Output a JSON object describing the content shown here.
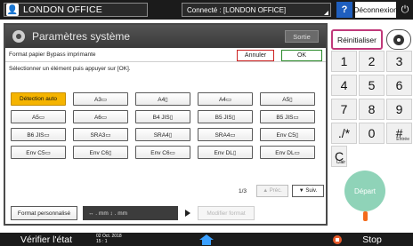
{
  "topbar": {
    "user": "LONDON OFFICE",
    "connection": "Connecté : [LONDON OFFICE]",
    "help": "?",
    "logout": "Déconnexion",
    "power_icon": "power-icon"
  },
  "window": {
    "title": "Paramètres système",
    "exit": "Sortie",
    "heading": "Format papier Bypass imprimante",
    "cancel": "Annuler",
    "ok": "OK",
    "instruction": "Sélectionner un élément puis appuyer sur [OK]."
  },
  "sizes": [
    {
      "label": "Détection auto",
      "selected": true
    },
    {
      "label": "A3▭",
      "selected": false
    },
    {
      "label": "A4▯",
      "selected": false
    },
    {
      "label": "A4▭",
      "selected": false
    },
    {
      "label": "A5▯",
      "selected": false
    },
    {
      "label": "A5▭",
      "selected": false
    },
    {
      "label": "A6▭",
      "selected": false
    },
    {
      "label": "B4 JIS▯",
      "selected": false
    },
    {
      "label": "B5 JIS▯",
      "selected": false
    },
    {
      "label": "B5 JIS▭",
      "selected": false
    },
    {
      "label": "B6 JIS▭",
      "selected": false
    },
    {
      "label": "SRA3▭",
      "selected": false
    },
    {
      "label": "SRA4▯",
      "selected": false
    },
    {
      "label": "SRA4▭",
      "selected": false
    },
    {
      "label": "Env C5▯",
      "selected": false
    },
    {
      "label": "Env C5▭",
      "selected": false
    },
    {
      "label": "Env C6▯",
      "selected": false
    },
    {
      "label": "Env C6▭",
      "selected": false
    },
    {
      "label": "Env DL▯",
      "selected": false
    },
    {
      "label": "Env DL▭",
      "selected": false
    }
  ],
  "pager": {
    "page": "1/3",
    "prev": "▲ Préc.",
    "next": "▼ Suiv."
  },
  "custom": {
    "button": "Format personnalisé",
    "dims": "↔   . mm ↕   . mm",
    "modify": "Modifier format"
  },
  "right": {
    "reset": "Réinitialiser",
    "keys": [
      {
        "label": "1",
        "sub": ""
      },
      {
        "label": "2",
        "sub": ""
      },
      {
        "label": "3",
        "sub": ""
      },
      {
        "label": "4",
        "sub": ""
      },
      {
        "label": "5",
        "sub": ""
      },
      {
        "label": "6",
        "sub": ""
      },
      {
        "label": "7",
        "sub": ""
      },
      {
        "label": "8",
        "sub": ""
      },
      {
        "label": "9",
        "sub": ""
      },
      {
        "label": "./*",
        "sub": ""
      },
      {
        "label": "0",
        "sub": ""
      },
      {
        "label": "#",
        "sub": "Entrée"
      }
    ],
    "clear": "C",
    "clear_sub": "Clair",
    "start": "Départ"
  },
  "bottombar": {
    "status": "Vérifier l'état",
    "date": "02 Oct. 2018",
    "time": "15 : 1",
    "stop": "Stop"
  },
  "colors": {
    "selected": "#f5b400",
    "reset_border": "#c0397a",
    "start": "#8fd3b8",
    "help": "#1f5fbf"
  }
}
